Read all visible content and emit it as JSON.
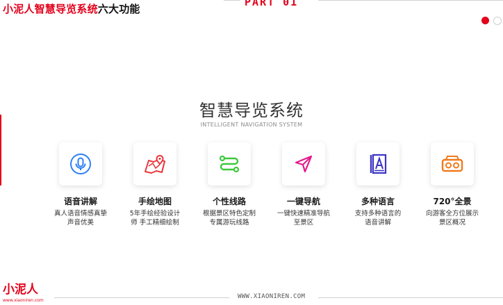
{
  "header": {
    "title_red": "小泥人智慧导览系统",
    "title_dark": "六大功能",
    "part_label": "PART 01"
  },
  "section": {
    "title": "智慧导览系统",
    "subtitle": "INTELLIGENT NAVIGATION SYSTEM"
  },
  "features": [
    {
      "title": "语音讲解",
      "desc1": "真人语音情感真挚",
      "desc2": "声音优美",
      "icon": "microphone-icon",
      "color": "#2d7ff9"
    },
    {
      "title": "手绘地图",
      "desc1": "5年手绘经验设计",
      "desc2": "师 手工精细绘制",
      "icon": "map-icon",
      "color": "#e8383d"
    },
    {
      "title": "个性线路",
      "desc1": "根据景区特色定制",
      "desc2": "专属游玩线路",
      "icon": "route-icon",
      "color": "#3cc83c"
    },
    {
      "title": "一键导航",
      "desc1": "一键快速精准导航",
      "desc2": "至景区",
      "icon": "navigation-icon",
      "color": "#e5188b"
    },
    {
      "title": "多种语言",
      "desc1": "支持多种语言的",
      "desc2": "语音讲解",
      "icon": "language-book-icon",
      "color": "#3b33c4"
    },
    {
      "title": "720°全景",
      "desc1": "向游客全方位展示",
      "desc2": "景区概况",
      "icon": "vr-glasses-icon",
      "color": "#f07a1d"
    }
  ],
  "footer": {
    "logo": "小泥人",
    "logo_url": "www.xiaoniren.com",
    "url": "WWW.XIAONIREN.COM"
  },
  "colors": {
    "accent": "#e3001b"
  }
}
